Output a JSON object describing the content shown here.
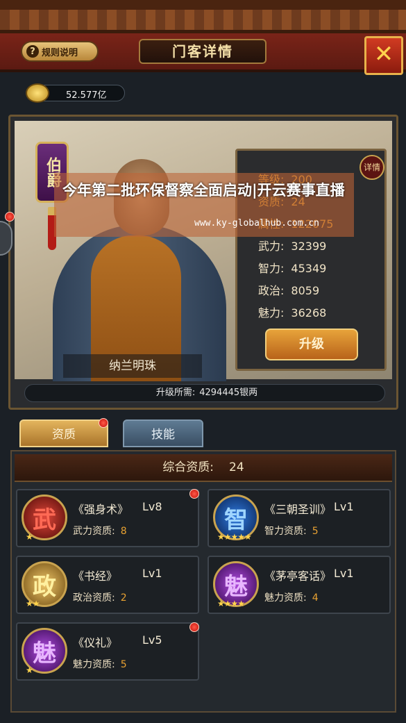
{
  "header": {
    "rules_label": "规则说明",
    "rules_icon": "question-icon",
    "title": "门客详情",
    "close_icon": "close-icon"
  },
  "currency": {
    "icon": "coin-icon",
    "value": "52.577亿"
  },
  "hero": {
    "rank": "伯爵",
    "name": "纳兰明珠",
    "detail_label": "详情",
    "stats": [
      {
        "label": "等级:",
        "value": "200",
        "highlight": true
      },
      {
        "label": "资质:",
        "value": "24",
        "highlight": true
      },
      {
        "label": "属性:",
        "value": "122075",
        "highlight": true
      },
      {
        "label": "武力:",
        "value": "32399",
        "highlight": false
      },
      {
        "label": "智力:",
        "value": "45349",
        "highlight": false
      },
      {
        "label": "政治:",
        "value": "8059",
        "highlight": false
      },
      {
        "label": "魅力:",
        "value": "36268",
        "highlight": false
      }
    ],
    "upgrade_label": "升级",
    "cost_label": "升级所需:",
    "cost_value": "4294445银两"
  },
  "tabs": [
    {
      "label": "资质",
      "active": true
    },
    {
      "label": "技能",
      "active": false
    }
  ],
  "aptitude": {
    "total_label": "综合资质:",
    "total_value": "24",
    "skills": [
      {
        "glyph": "武",
        "name": "《强身术》",
        "level": "Lv8",
        "attr_label": "武力资质:",
        "attr_value": "8",
        "stars": "★",
        "orb": "red",
        "alert": true
      },
      {
        "glyph": "智",
        "name": "《三朝圣训》",
        "level": "Lv1",
        "attr_label": "智力资质:",
        "attr_value": "5",
        "stars": "★★★★★",
        "orb": "blue",
        "alert": false
      },
      {
        "glyph": "政",
        "name": "《书经》",
        "level": "Lv1",
        "attr_label": "政治资质:",
        "attr_value": "2",
        "stars": "★★",
        "orb": "gold",
        "alert": false
      },
      {
        "glyph": "魅",
        "name": "《茅亭客话》",
        "level": "Lv1",
        "attr_label": "魅力资质:",
        "attr_value": "4",
        "stars": "★★★★",
        "orb": "purple",
        "alert": false
      },
      {
        "glyph": "魅",
        "name": "《仪礼》",
        "level": "Lv5",
        "attr_label": "魅力资质:",
        "attr_value": "5",
        "stars": "★",
        "orb": "purple",
        "alert": true
      }
    ]
  },
  "overlay": {
    "headline": "今年第二批环保督察全面启动|开云赛事直播",
    "url": "www.ky-globalhub.com.cn"
  },
  "colors": {
    "accent_gold": "#e9a232",
    "alert_red": "#c20e06",
    "panel_dark": "#24292e"
  }
}
